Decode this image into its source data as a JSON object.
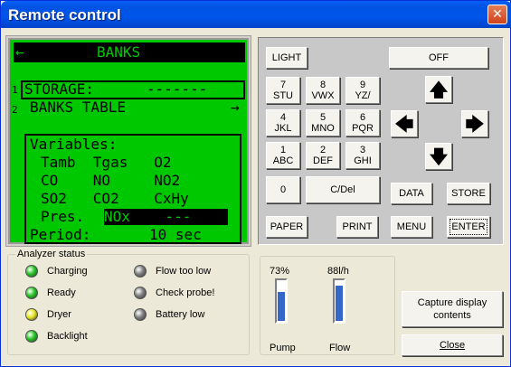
{
  "window": {
    "title": "Remote control",
    "close_glyph": "✕"
  },
  "lcd": {
    "header_arrow": "←",
    "header": "BANKS",
    "line1_num": "1",
    "line1": "STORAGE:      -------",
    "line2_num": "2",
    "line2": "BANKS TABLE",
    "line2_arrow": "→",
    "vars_title": "Variables:",
    "row1": "Tamb  Tgas   O2",
    "row2": "CO    NO     NO2",
    "row3": "SO2   CO2    CxHy",
    "row4_a": "Pres.",
    "row4_b": "NOx    ---",
    "period_label": "Period:",
    "period_value": "10 sec"
  },
  "keys": {
    "light": "LIGHT",
    "off": "OFF",
    "k7n": "7",
    "k7l": "STU",
    "k8n": "8",
    "k8l": "VWX",
    "k9n": "9",
    "k9l": "YZ/",
    "k4n": "4",
    "k4l": "JKL",
    "k5n": "5",
    "k5l": "MNO",
    "k6n": "6",
    "k6l": "PQR",
    "k1n": "1",
    "k1l": "ABC",
    "k2n": "2",
    "k2l": "DEF",
    "k3n": "3",
    "k3l": "GHI",
    "k0": "0",
    "cdel": "C/Del",
    "data": "DATA",
    "store": "STORE",
    "paper": "PAPER",
    "print": "PRINT",
    "menu": "MENU",
    "enter": "ENTER",
    "up": "🡅",
    "down": "🡇",
    "left": "🡄",
    "right": "🡆"
  },
  "status": {
    "title": "Analyzer status",
    "leds_left": [
      {
        "label": "Charging",
        "color": "#22c822"
      },
      {
        "label": "Ready",
        "color": "#22c822"
      },
      {
        "label": "Dryer",
        "color": "#e8e822"
      },
      {
        "label": "Backlight",
        "color": "#22c822"
      }
    ],
    "leds_right": [
      {
        "label": "Flow too low",
        "color": "#808080"
      },
      {
        "label": "Check probe!",
        "color": "#808080"
      },
      {
        "label": "Battery low",
        "color": "#808080"
      }
    ]
  },
  "meters": {
    "pump_value": "73%",
    "pump_label": "Pump",
    "pump_fill": 0.73,
    "flow_value": "88l/h",
    "flow_label": "Flow",
    "flow_fill": 0.88
  },
  "actions": {
    "capture": "Capture display contents",
    "close": "Close"
  }
}
